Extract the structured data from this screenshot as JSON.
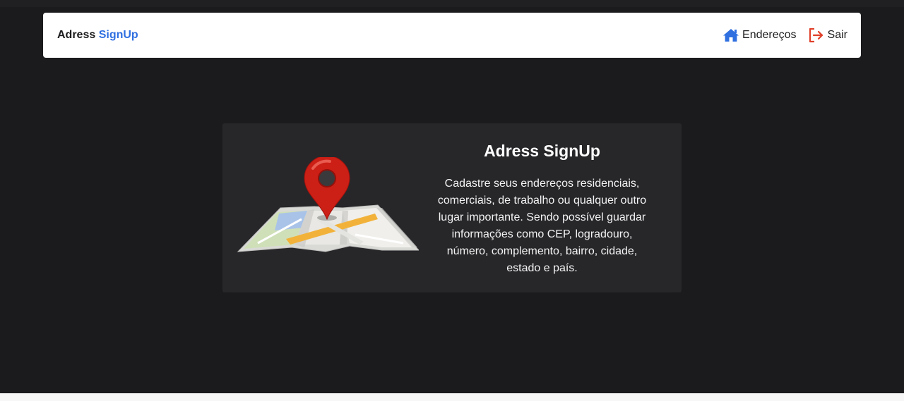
{
  "navbar": {
    "brand_prefix": "Adress",
    "brand_accent": "SignUp",
    "links": [
      {
        "label": "Endereços",
        "icon": "home-icon",
        "color": "#2f6fe0"
      },
      {
        "label": "Sair",
        "icon": "logout-icon",
        "color": "#e0402a"
      }
    ]
  },
  "hero": {
    "title": "Adress SignUp",
    "description": "Cadastre seus endereços residenciais, comerciais, de trabalho ou qualquer outro lugar importante. Sendo possível guardar informações como CEP, logradouro, número, complemento, bairro, cidade, estado e país.",
    "image": "map-pin-illustration"
  },
  "colors": {
    "background": "#1b1b1d",
    "card": "#27272a",
    "navbar": "#ffffff",
    "accent": "#2f6fe0",
    "logout": "#e0402a"
  }
}
